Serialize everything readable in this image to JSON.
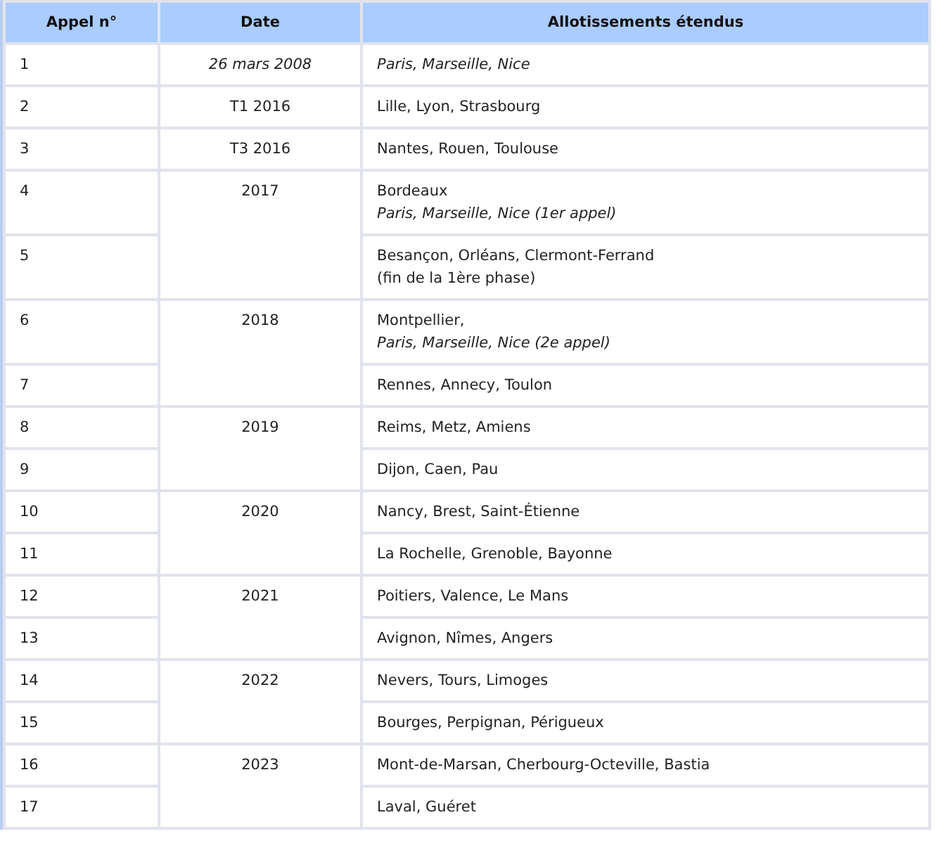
{
  "table": {
    "columns": [
      "Appel n°",
      "Date",
      "Allotissements étendus"
    ],
    "groups": [
      {
        "date": "26 mars 2008",
        "italic": true,
        "rows": [
          {
            "number": "1",
            "lines": [
              {
                "text": "Paris, Marseille, Nice",
                "italic": true
              }
            ]
          }
        ]
      },
      {
        "date": "T1 2016",
        "italic": false,
        "rows": [
          {
            "number": "2",
            "lines": [
              {
                "text": "Lille, Lyon, Strasbourg",
                "italic": false
              }
            ]
          }
        ]
      },
      {
        "date": "T3 2016",
        "italic": false,
        "rows": [
          {
            "number": "3",
            "lines": [
              {
                "text": "Nantes, Rouen, Toulouse",
                "italic": false
              }
            ]
          }
        ]
      },
      {
        "date": "2017",
        "italic": false,
        "rows": [
          {
            "number": "4",
            "lines": [
              {
                "text": "Bordeaux",
                "italic": false
              },
              {
                "text": "Paris, Marseille, Nice (1er appel)",
                "italic": true
              }
            ]
          },
          {
            "number": "5",
            "lines": [
              {
                "text": "Besançon, Orléans, Clermont-Ferrand",
                "italic": false
              },
              {
                "text": "(fin de la 1ère phase)",
                "italic": false
              }
            ]
          }
        ]
      },
      {
        "date": "2018",
        "italic": false,
        "rows": [
          {
            "number": "6",
            "lines": [
              {
                "text": "Montpellier,",
                "italic": false
              },
              {
                "text": "Paris, Marseille, Nice (2e appel)",
                "italic": true
              }
            ]
          },
          {
            "number": "7",
            "lines": [
              {
                "text": "Rennes, Annecy, Toulon",
                "italic": false
              }
            ]
          }
        ]
      },
      {
        "date": "2019",
        "italic": false,
        "rows": [
          {
            "number": "8",
            "lines": [
              {
                "text": "Reims, Metz, Amiens",
                "italic": false
              }
            ]
          },
          {
            "number": "9",
            "lines": [
              {
                "text": "Dijon, Caen, Pau",
                "italic": false
              }
            ]
          }
        ]
      },
      {
        "date": "2020",
        "italic": false,
        "rows": [
          {
            "number": "10",
            "lines": [
              {
                "text": "Nancy, Brest, Saint-Étienne",
                "italic": false
              }
            ]
          },
          {
            "number": "11",
            "lines": [
              {
                "text": "La Rochelle, Grenoble, Bayonne",
                "italic": false
              }
            ]
          }
        ]
      },
      {
        "date": "2021",
        "italic": false,
        "rows": [
          {
            "number": "12",
            "lines": [
              {
                "text": "Poitiers, Valence, Le Mans",
                "italic": false
              }
            ]
          },
          {
            "number": "13",
            "lines": [
              {
                "text": "Avignon, Nîmes, Angers",
                "italic": false
              }
            ]
          }
        ]
      },
      {
        "date": "2022",
        "italic": false,
        "rows": [
          {
            "number": "14",
            "lines": [
              {
                "text": "Nevers, Tours, Limoges",
                "italic": false
              }
            ]
          },
          {
            "number": "15",
            "lines": [
              {
                "text": "Bourges, Perpignan, Périgueux",
                "italic": false
              }
            ]
          }
        ]
      },
      {
        "date": "2023",
        "italic": false,
        "rows": [
          {
            "number": "16",
            "lines": [
              {
                "text": "Mont-de-Marsan, Cherbourg-Octeville, Bastia",
                "italic": false
              }
            ]
          },
          {
            "number": "17",
            "lines": [
              {
                "text": "Laval, Guéret",
                "italic": false
              }
            ]
          }
        ]
      }
    ]
  }
}
